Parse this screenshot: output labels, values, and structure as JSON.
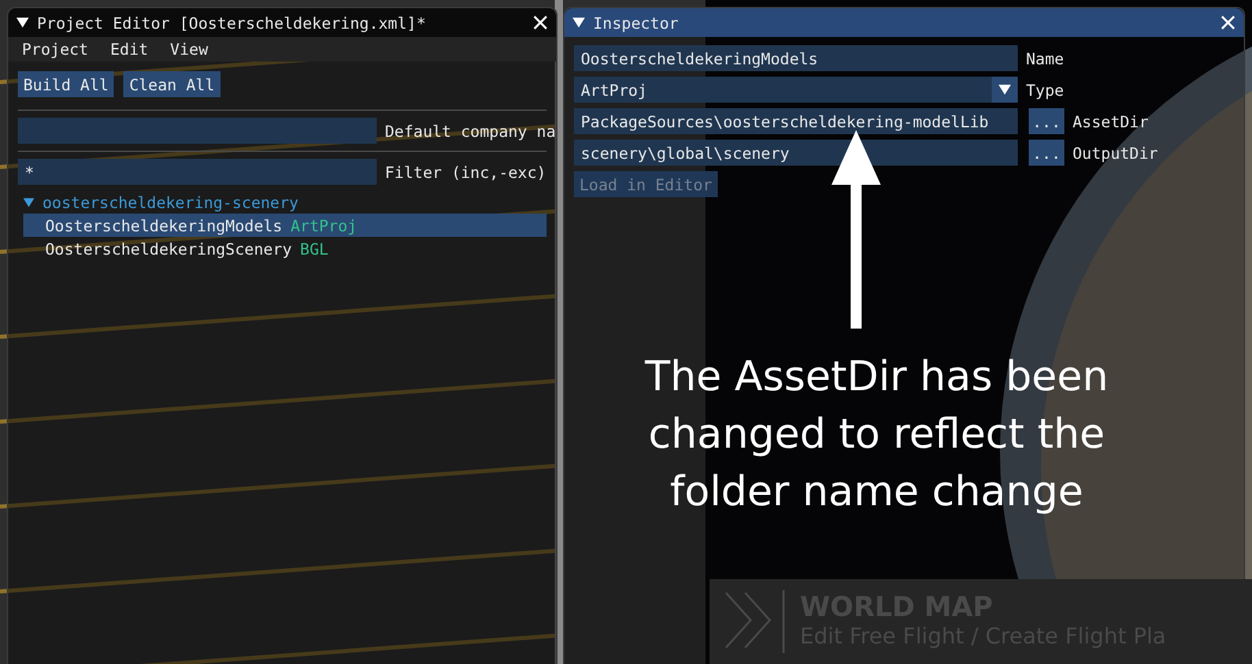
{
  "project_editor": {
    "title": "Project Editor [Oosterscheldekering.xml]*",
    "focused": false,
    "menu": [
      "Project",
      "Edit",
      "View"
    ],
    "buttons": [
      "Build All",
      "Clean All"
    ],
    "company_field": {
      "label": "Default company na"
    },
    "filter": {
      "value": "*",
      "label": "Filter (inc,-exc)"
    },
    "tree": [
      {
        "label": "oosterscheldekering-scenery",
        "expanded": true,
        "children": [
          {
            "name": "OosterscheldekeringModels",
            "type": "ArtProj",
            "selected": true
          },
          {
            "name": "OosterscheldekeringScenery",
            "type": "BGL",
            "selected": false
          }
        ]
      }
    ]
  },
  "inspector": {
    "title": "Inspector",
    "focused": true,
    "fields": [
      {
        "kind": "text",
        "value": "OosterscheldekeringModels",
        "label": "Name"
      },
      {
        "kind": "dropdown",
        "value": "ArtProj",
        "label": "Type"
      },
      {
        "kind": "path",
        "value": "PackageSources\\oosterscheldekering-modelLib",
        "browse": "...",
        "label": "AssetDir"
      },
      {
        "kind": "path",
        "value": "scenery\\global\\scenery",
        "browse": "...",
        "label": "OutputDir"
      }
    ],
    "load_button": {
      "label": "Load in Editor",
      "disabled": true
    }
  },
  "annotation": {
    "text": "The AssetDir has been changed to reflect the folder name change"
  },
  "world_map": {
    "title": "WORLD MAP",
    "subtitle": "Edit Free Flight / Create Flight Pla"
  }
}
